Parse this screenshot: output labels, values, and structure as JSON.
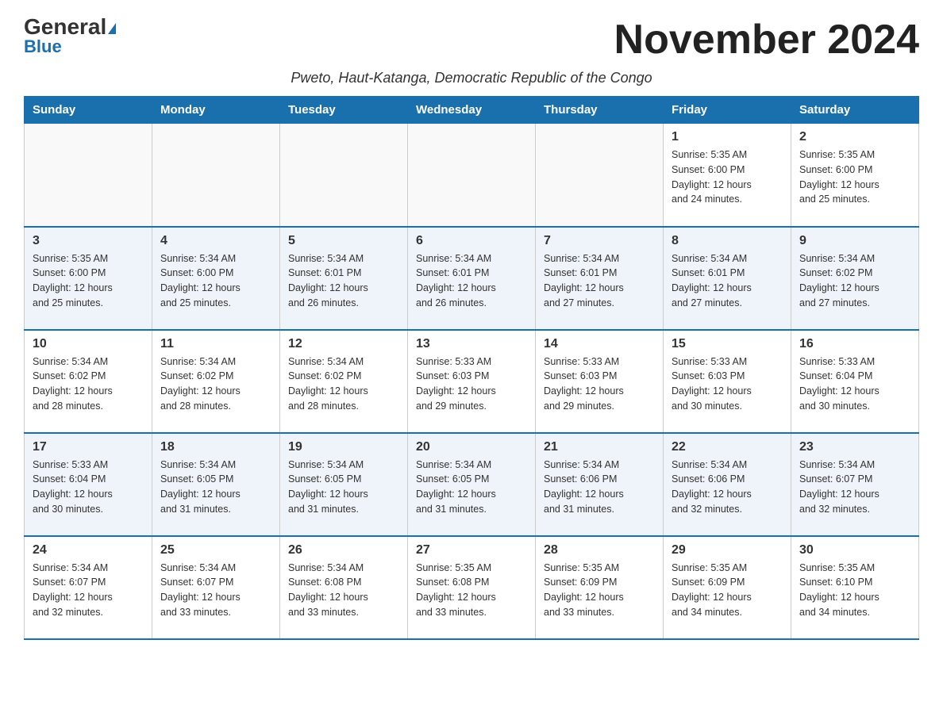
{
  "logo": {
    "line1": "General",
    "line2": "Blue"
  },
  "title": "November 2024",
  "subtitle": "Pweto, Haut-Katanga, Democratic Republic of the Congo",
  "days_header": [
    "Sunday",
    "Monday",
    "Tuesday",
    "Wednesday",
    "Thursday",
    "Friday",
    "Saturday"
  ],
  "weeks": [
    [
      {
        "day": "",
        "info": ""
      },
      {
        "day": "",
        "info": ""
      },
      {
        "day": "",
        "info": ""
      },
      {
        "day": "",
        "info": ""
      },
      {
        "day": "",
        "info": ""
      },
      {
        "day": "1",
        "info": "Sunrise: 5:35 AM\nSunset: 6:00 PM\nDaylight: 12 hours\nand 24 minutes."
      },
      {
        "day": "2",
        "info": "Sunrise: 5:35 AM\nSunset: 6:00 PM\nDaylight: 12 hours\nand 25 minutes."
      }
    ],
    [
      {
        "day": "3",
        "info": "Sunrise: 5:35 AM\nSunset: 6:00 PM\nDaylight: 12 hours\nand 25 minutes."
      },
      {
        "day": "4",
        "info": "Sunrise: 5:34 AM\nSunset: 6:00 PM\nDaylight: 12 hours\nand 25 minutes."
      },
      {
        "day": "5",
        "info": "Sunrise: 5:34 AM\nSunset: 6:01 PM\nDaylight: 12 hours\nand 26 minutes."
      },
      {
        "day": "6",
        "info": "Sunrise: 5:34 AM\nSunset: 6:01 PM\nDaylight: 12 hours\nand 26 minutes."
      },
      {
        "day": "7",
        "info": "Sunrise: 5:34 AM\nSunset: 6:01 PM\nDaylight: 12 hours\nand 27 minutes."
      },
      {
        "day": "8",
        "info": "Sunrise: 5:34 AM\nSunset: 6:01 PM\nDaylight: 12 hours\nand 27 minutes."
      },
      {
        "day": "9",
        "info": "Sunrise: 5:34 AM\nSunset: 6:02 PM\nDaylight: 12 hours\nand 27 minutes."
      }
    ],
    [
      {
        "day": "10",
        "info": "Sunrise: 5:34 AM\nSunset: 6:02 PM\nDaylight: 12 hours\nand 28 minutes."
      },
      {
        "day": "11",
        "info": "Sunrise: 5:34 AM\nSunset: 6:02 PM\nDaylight: 12 hours\nand 28 minutes."
      },
      {
        "day": "12",
        "info": "Sunrise: 5:34 AM\nSunset: 6:02 PM\nDaylight: 12 hours\nand 28 minutes."
      },
      {
        "day": "13",
        "info": "Sunrise: 5:33 AM\nSunset: 6:03 PM\nDaylight: 12 hours\nand 29 minutes."
      },
      {
        "day": "14",
        "info": "Sunrise: 5:33 AM\nSunset: 6:03 PM\nDaylight: 12 hours\nand 29 minutes."
      },
      {
        "day": "15",
        "info": "Sunrise: 5:33 AM\nSunset: 6:03 PM\nDaylight: 12 hours\nand 30 minutes."
      },
      {
        "day": "16",
        "info": "Sunrise: 5:33 AM\nSunset: 6:04 PM\nDaylight: 12 hours\nand 30 minutes."
      }
    ],
    [
      {
        "day": "17",
        "info": "Sunrise: 5:33 AM\nSunset: 6:04 PM\nDaylight: 12 hours\nand 30 minutes."
      },
      {
        "day": "18",
        "info": "Sunrise: 5:34 AM\nSunset: 6:05 PM\nDaylight: 12 hours\nand 31 minutes."
      },
      {
        "day": "19",
        "info": "Sunrise: 5:34 AM\nSunset: 6:05 PM\nDaylight: 12 hours\nand 31 minutes."
      },
      {
        "day": "20",
        "info": "Sunrise: 5:34 AM\nSunset: 6:05 PM\nDaylight: 12 hours\nand 31 minutes."
      },
      {
        "day": "21",
        "info": "Sunrise: 5:34 AM\nSunset: 6:06 PM\nDaylight: 12 hours\nand 31 minutes."
      },
      {
        "day": "22",
        "info": "Sunrise: 5:34 AM\nSunset: 6:06 PM\nDaylight: 12 hours\nand 32 minutes."
      },
      {
        "day": "23",
        "info": "Sunrise: 5:34 AM\nSunset: 6:07 PM\nDaylight: 12 hours\nand 32 minutes."
      }
    ],
    [
      {
        "day": "24",
        "info": "Sunrise: 5:34 AM\nSunset: 6:07 PM\nDaylight: 12 hours\nand 32 minutes."
      },
      {
        "day": "25",
        "info": "Sunrise: 5:34 AM\nSunset: 6:07 PM\nDaylight: 12 hours\nand 33 minutes."
      },
      {
        "day": "26",
        "info": "Sunrise: 5:34 AM\nSunset: 6:08 PM\nDaylight: 12 hours\nand 33 minutes."
      },
      {
        "day": "27",
        "info": "Sunrise: 5:35 AM\nSunset: 6:08 PM\nDaylight: 12 hours\nand 33 minutes."
      },
      {
        "day": "28",
        "info": "Sunrise: 5:35 AM\nSunset: 6:09 PM\nDaylight: 12 hours\nand 33 minutes."
      },
      {
        "day": "29",
        "info": "Sunrise: 5:35 AM\nSunset: 6:09 PM\nDaylight: 12 hours\nand 34 minutes."
      },
      {
        "day": "30",
        "info": "Sunrise: 5:35 AM\nSunset: 6:10 PM\nDaylight: 12 hours\nand 34 minutes."
      }
    ]
  ]
}
